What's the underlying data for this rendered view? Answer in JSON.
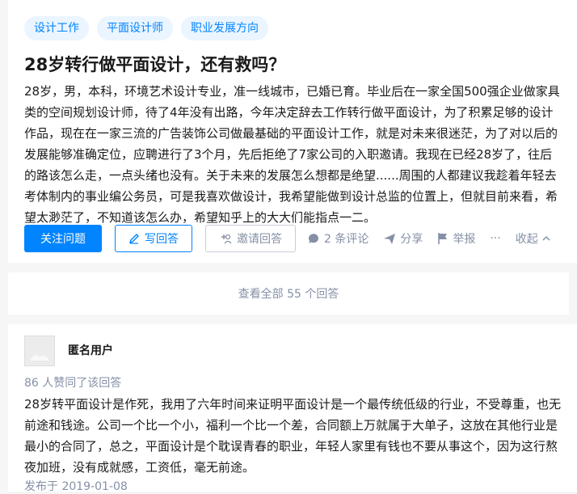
{
  "question": {
    "topics": [
      "设计工作",
      "平面设计师",
      "职业发展方向"
    ],
    "title": "28岁转行做平面设计，还有救吗？",
    "detail": "28岁，男，本科，环境艺术设计专业，准一线城市，已婚已育。毕业后在一家全国500强企业做家具类的空间规划设计师，待了4年没有出路，今年决定辞去工作转行做平面设计，为了积累足够的设计作品，现在在一家三流的广告装饰公司做最基础的平面设计工作，就是对未来很迷茫，为了对以后的发展能够准确定位，应聘进行了3个月，先后拒绝了7家公司的入职邀请。我现在已经28岁了，往后的路该怎么走，一点头绪也没有。关于未来的发展怎么想都是绝望......周围的人都建议我趁着年轻去考体制内的事业编公务员，可是我喜欢做设计，我希望能做到设计总监的位置上，但就目前来看，希望太渺茫了，不知道该怎么办，希望知乎上的大大们能指点一二。",
    "actions": {
      "follow": "关注问题",
      "write": "写回答",
      "invite": "邀请回答",
      "comments": "2 条评论",
      "share": "分享",
      "report": "举报",
      "more": "···",
      "collapse": "收起"
    }
  },
  "view_all": "查看全部 55 个回答",
  "answer": {
    "author": "匿名用户",
    "votes": "86 人赞同了该回答",
    "text": "28岁转平面设计是作死，我用了六年时间来证明平面设计是一个最传统低级的行业，不受尊重，也无前途和钱途。公司一个比一个小，福利一个比一个差，合同额上万就属于大单子，这放在其他行业是最小的合同了，总之，平面设计是个耽误青春的职业，年轻人家里有钱也不要从事这个，因为这行熬夜加班，没有成就感，工资低，毫无前途。",
    "published": "发布于 2019-01-08"
  },
  "colors": {
    "brand": "#0084ff",
    "muted": "#8590a6",
    "topic_bg": "#ebf5ff"
  }
}
